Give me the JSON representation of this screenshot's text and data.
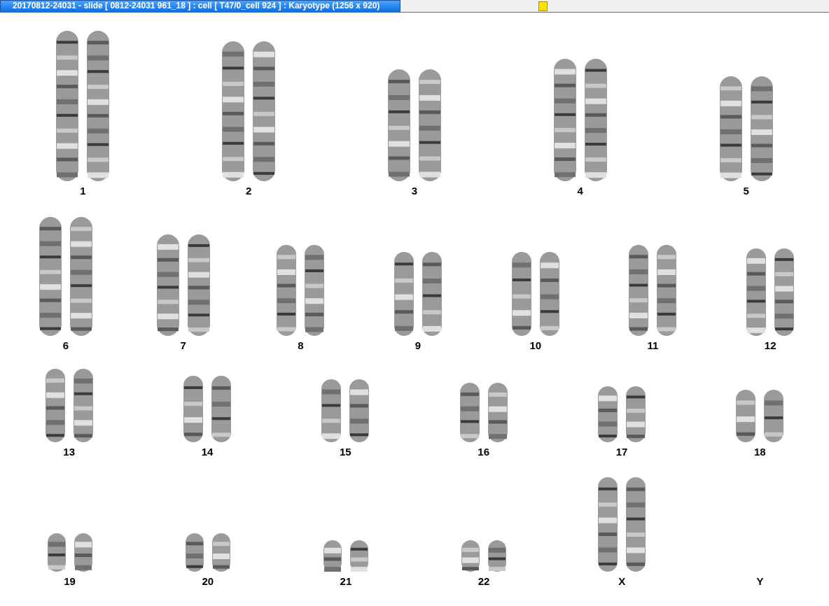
{
  "window": {
    "title": "20170812-24031 - slide [ 0812-24031 961_18 ] : cell [ T47/0_cell 924 ] : Karyotype  (1256 x 920)"
  },
  "rows": [
    {
      "pairs": [
        {
          "label": "1",
          "kind": "pair"
        },
        {
          "label": "2",
          "kind": "pair"
        },
        {
          "label": "3",
          "kind": "pair"
        },
        {
          "label": "4",
          "kind": "pair"
        },
        {
          "label": "5",
          "kind": "pair"
        }
      ]
    },
    {
      "pairs": [
        {
          "label": "6",
          "kind": "pair"
        },
        {
          "label": "7",
          "kind": "pair"
        },
        {
          "label": "8",
          "kind": "pair"
        },
        {
          "label": "9",
          "kind": "pair"
        },
        {
          "label": "10",
          "kind": "pair"
        },
        {
          "label": "11",
          "kind": "pair"
        },
        {
          "label": "12",
          "kind": "pair"
        }
      ]
    },
    {
      "pairs": [
        {
          "label": "13",
          "kind": "pair"
        },
        {
          "label": "14",
          "kind": "pair"
        },
        {
          "label": "15",
          "kind": "pair"
        },
        {
          "label": "16",
          "kind": "pair"
        },
        {
          "label": "17",
          "kind": "pair"
        },
        {
          "label": "18",
          "kind": "pair"
        }
      ]
    },
    {
      "pairs": [
        {
          "label": "19",
          "kind": "pair"
        },
        {
          "label": "20",
          "kind": "pair"
        },
        {
          "label": "21",
          "kind": "pair"
        },
        {
          "label": "22",
          "kind": "pair"
        },
        {
          "label": "X",
          "kind": "pair"
        },
        {
          "label": "Y",
          "kind": "empty"
        }
      ]
    }
  ]
}
